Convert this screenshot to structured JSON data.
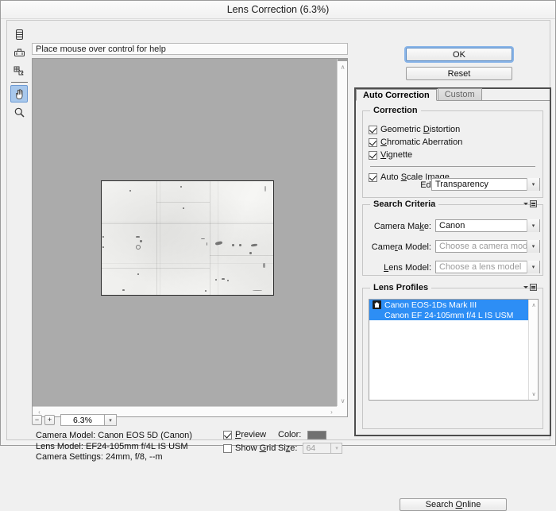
{
  "window": {
    "title": "Lens Correction (6.3%)"
  },
  "help": {
    "text": "Place mouse over control for help"
  },
  "toolbar": {
    "tools": [
      {
        "name": "remove-distortion-tool",
        "label": "Remove Distortion Tool",
        "selected": false
      },
      {
        "name": "straighten-tool",
        "label": "Straighten Tool",
        "selected": false
      },
      {
        "name": "move-grid-tool",
        "label": "Move Grid Tool",
        "selected": false
      },
      {
        "name": "hand-tool",
        "label": "Hand Tool",
        "selected": true
      },
      {
        "name": "zoom-tool",
        "label": "Zoom Tool",
        "selected": false
      }
    ]
  },
  "zoom_control": {
    "minus": "−",
    "plus": "+",
    "value": "6.3%",
    "caret": "▾"
  },
  "status": {
    "camera_model": "Camera Model: Canon EOS 5D (Canon)",
    "lens_model": "Lens Model: EF24-105mm f/4L IS USM",
    "camera_settings": "Camera Settings: 24mm, f/8, --m"
  },
  "view_options": {
    "preview_label": "Preview",
    "preview_checked": true,
    "show_grid_label": "Show Grid",
    "show_grid_checked": false,
    "color_label": "Color:",
    "color_value": "#707070",
    "size_label": "Size:",
    "size_value": "64",
    "size_caret": "▾"
  },
  "buttons": {
    "ok": "OK",
    "reset": "Reset",
    "search_online": "Search Online"
  },
  "panel": {
    "tabs": [
      {
        "label": "Auto Correction",
        "active": true
      },
      {
        "label": "Custom",
        "active": false
      }
    ],
    "correction": {
      "title": "Correction",
      "checks": [
        {
          "label": "Geometric Distortion",
          "checked": true
        },
        {
          "label": "Chromatic Aberration",
          "checked": true
        },
        {
          "label": "Vignette",
          "checked": true
        }
      ],
      "auto_scale": {
        "label": "Auto Scale Image",
        "checked": true
      },
      "edge_label": "Edge:",
      "edge_value": "Transparency",
      "caret": "▾"
    },
    "search_criteria": {
      "title": "Search Criteria",
      "fields": [
        {
          "label": "Camera Make:",
          "value": "Canon",
          "placeholder": false
        },
        {
          "label": "Camera Model:",
          "value": "Choose a camera model",
          "placeholder": true
        },
        {
          "label": "Lens Model:",
          "value": "Choose a lens model",
          "placeholder": true
        }
      ],
      "caret": "▾"
    },
    "lens_profiles": {
      "title": "Lens Profiles",
      "items": [
        {
          "camera": "Canon EOS-1Ds Mark III",
          "lens": "Canon EF 24-105mm f/4 L IS USM",
          "selected": true
        }
      ],
      "scroll_up": "∧",
      "scroll_down": "∨"
    }
  },
  "scrollbars": {
    "up": "∧",
    "down": "∨",
    "left": "‹",
    "right": "›"
  }
}
